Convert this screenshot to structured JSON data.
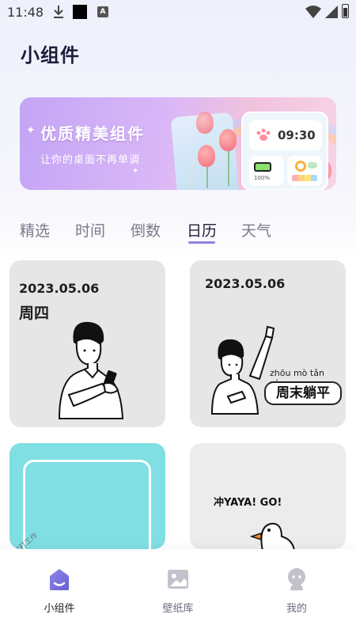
{
  "status_bar": {
    "time": "11:48",
    "badge": "A"
  },
  "header": {
    "title": "小组件"
  },
  "banner": {
    "title": "优质精美组件",
    "subtitle": "让你的桌面不再单调",
    "preview_time": "09:30",
    "preview_battery": "100%"
  },
  "tabs": [
    {
      "label": "精选",
      "active": false
    },
    {
      "label": "时间",
      "active": false
    },
    {
      "label": "倒数",
      "active": false
    },
    {
      "label": "日历",
      "active": true
    },
    {
      "label": "天气",
      "active": false
    }
  ],
  "cards": [
    {
      "date": "2023.05.06",
      "weekday": "周四"
    },
    {
      "date": "2023.05.06",
      "pinyin": "zhōu mò  tǎn píng",
      "slogan": "周末躺平"
    },
    {
      "stamp": "打打工作"
    },
    {
      "title": "冲YAYA! GO!"
    }
  ],
  "bottom_nav": [
    {
      "label": "小组件",
      "icon": "widget-home-icon",
      "active": true
    },
    {
      "label": "壁纸库",
      "icon": "wallpaper-icon",
      "active": false
    },
    {
      "label": "我的",
      "icon": "profile-icon",
      "active": false
    }
  ],
  "colors": {
    "accent": "#8b82e0",
    "teal": "#7fdfe3",
    "card_gray": "#e6e6e6"
  }
}
